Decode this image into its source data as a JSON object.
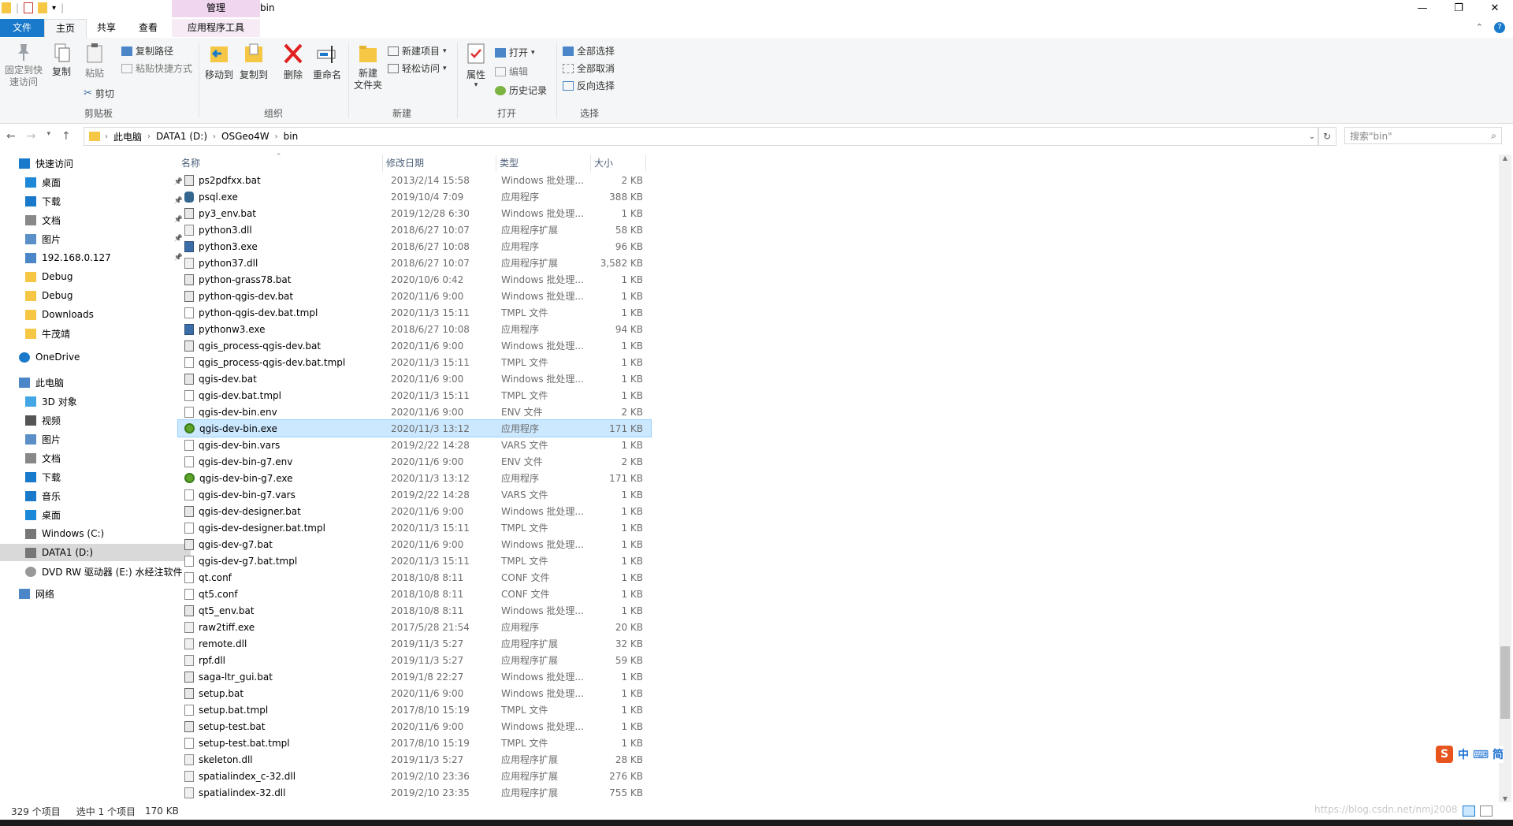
{
  "window": {
    "title": "bin",
    "context_tab_header": "管理",
    "controls": [
      "—",
      "❐",
      "✕"
    ]
  },
  "tabs": {
    "file": "文件",
    "home": "主页",
    "share": "共享",
    "view": "查看",
    "app_tools": "应用程序工具"
  },
  "ribbon": {
    "clipboard": {
      "label": "剪贴板",
      "pin": "固定到快\n速访问",
      "copy": "复制",
      "paste": "粘贴",
      "copy_path": "复制路径",
      "paste_shortcut": "粘贴快捷方式",
      "cut": "剪切"
    },
    "organize": {
      "label": "组织",
      "move_to": "移动到",
      "copy_to": "复制到",
      "delete": "删除",
      "rename": "重命名"
    },
    "new": {
      "label": "新建",
      "new_folder": "新建\n文件夹",
      "new_item": "新建项目",
      "easy_access": "轻松访问"
    },
    "open": {
      "label": "打开",
      "properties": "属性",
      "open": "打开",
      "edit": "编辑",
      "history": "历史记录"
    },
    "select": {
      "label": "选择",
      "select_all": "全部选择",
      "select_none": "全部取消",
      "invert": "反向选择"
    }
  },
  "address": {
    "crumbs": [
      "此电脑",
      "DATA1 (D:)",
      "OSGeo4W",
      "bin"
    ],
    "search_placeholder": "搜索\"bin\""
  },
  "nav": [
    {
      "label": "快速访问",
      "icon": "star-icon",
      "indent": 0,
      "pinned": false
    },
    {
      "label": "桌面",
      "icon": "desktop-icon",
      "indent": 1,
      "pinned": true
    },
    {
      "label": "下载",
      "icon": "download-icon",
      "indent": 1,
      "pinned": true
    },
    {
      "label": "文档",
      "icon": "document-icon",
      "indent": 1,
      "pinned": true
    },
    {
      "label": "图片",
      "icon": "pictures-icon",
      "indent": 1,
      "pinned": true
    },
    {
      "label": "192.168.0.127",
      "icon": "network-drive-icon",
      "indent": 1,
      "pinned": true
    },
    {
      "label": "Debug",
      "icon": "folder-icon",
      "indent": 1,
      "pinned": false
    },
    {
      "label": "Debug",
      "icon": "folder-icon",
      "indent": 1,
      "pinned": false
    },
    {
      "label": "Downloads",
      "icon": "folder-icon",
      "indent": 1,
      "pinned": false
    },
    {
      "label": "牛茂靖",
      "icon": "folder-icon",
      "indent": 1,
      "pinned": false
    },
    {
      "label": "OneDrive",
      "icon": "cloud-icon",
      "indent": 0,
      "pinned": false
    },
    {
      "label": "此电脑",
      "icon": "computer-icon",
      "indent": 0,
      "pinned": false
    },
    {
      "label": "3D 对象",
      "icon": "cube-icon",
      "indent": 1,
      "pinned": false
    },
    {
      "label": "视频",
      "icon": "video-icon",
      "indent": 1,
      "pinned": false
    },
    {
      "label": "图片",
      "icon": "pictures-icon",
      "indent": 1,
      "pinned": false
    },
    {
      "label": "文档",
      "icon": "document-icon",
      "indent": 1,
      "pinned": false
    },
    {
      "label": "下载",
      "icon": "download-icon",
      "indent": 1,
      "pinned": false
    },
    {
      "label": "音乐",
      "icon": "music-icon",
      "indent": 1,
      "pinned": false
    },
    {
      "label": "桌面",
      "icon": "desktop-icon",
      "indent": 1,
      "pinned": false
    },
    {
      "label": "Windows (C:)",
      "icon": "drive-icon",
      "indent": 1,
      "pinned": false
    },
    {
      "label": "DATA1 (D:)",
      "icon": "drive-icon",
      "indent": 1,
      "pinned": false,
      "selected": true
    },
    {
      "label": "DVD RW 驱动器 (E:) 水经注软件",
      "icon": "dvd-icon",
      "indent": 1,
      "pinned": false
    },
    {
      "label": "网络",
      "icon": "network-icon",
      "indent": 0,
      "pinned": false
    }
  ],
  "columns": {
    "name": "名称",
    "date": "修改日期",
    "type": "类型",
    "size": "大小"
  },
  "files": [
    {
      "name": "ps2pdfxx.bat",
      "date": "2013/2/14 15:58",
      "type": "Windows 批处理...",
      "size": "2 KB",
      "icon": "bat"
    },
    {
      "name": "psql.exe",
      "date": "2019/10/4 7:09",
      "type": "应用程序",
      "size": "388 KB",
      "icon": "psql"
    },
    {
      "name": "py3_env.bat",
      "date": "2019/12/28 6:30",
      "type": "Windows 批处理...",
      "size": "1 KB",
      "icon": "bat"
    },
    {
      "name": "python3.dll",
      "date": "2018/6/27 10:07",
      "type": "应用程序扩展",
      "size": "58 KB",
      "icon": "dll"
    },
    {
      "name": "python3.exe",
      "date": "2018/6/27 10:08",
      "type": "应用程序",
      "size": "96 KB",
      "icon": "py"
    },
    {
      "name": "python37.dll",
      "date": "2018/6/27 10:07",
      "type": "应用程序扩展",
      "size": "3,582 KB",
      "icon": "dll"
    },
    {
      "name": "python-grass78.bat",
      "date": "2020/10/6 0:42",
      "type": "Windows 批处理...",
      "size": "1 KB",
      "icon": "bat"
    },
    {
      "name": "python-qgis-dev.bat",
      "date": "2020/11/6 9:00",
      "type": "Windows 批处理...",
      "size": "1 KB",
      "icon": "bat"
    },
    {
      "name": "python-qgis-dev.bat.tmpl",
      "date": "2020/11/3 15:11",
      "type": "TMPL 文件",
      "size": "1 KB",
      "icon": "doc"
    },
    {
      "name": "pythonw3.exe",
      "date": "2018/6/27 10:08",
      "type": "应用程序",
      "size": "94 KB",
      "icon": "py"
    },
    {
      "name": "qgis_process-qgis-dev.bat",
      "date": "2020/11/6 9:00",
      "type": "Windows 批处理...",
      "size": "1 KB",
      "icon": "bat"
    },
    {
      "name": "qgis_process-qgis-dev.bat.tmpl",
      "date": "2020/11/3 15:11",
      "type": "TMPL 文件",
      "size": "1 KB",
      "icon": "doc"
    },
    {
      "name": "qgis-dev.bat",
      "date": "2020/11/6 9:00",
      "type": "Windows 批处理...",
      "size": "1 KB",
      "icon": "bat"
    },
    {
      "name": "qgis-dev.bat.tmpl",
      "date": "2020/11/3 15:11",
      "type": "TMPL 文件",
      "size": "1 KB",
      "icon": "doc"
    },
    {
      "name": "qgis-dev-bin.env",
      "date": "2020/11/6 9:00",
      "type": "ENV 文件",
      "size": "2 KB",
      "icon": "doc"
    },
    {
      "name": "qgis-dev-bin.exe",
      "date": "2020/11/3 13:12",
      "type": "应用程序",
      "size": "171 KB",
      "icon": "qgis",
      "selected": true
    },
    {
      "name": "qgis-dev-bin.vars",
      "date": "2019/2/22 14:28",
      "type": "VARS 文件",
      "size": "1 KB",
      "icon": "doc"
    },
    {
      "name": "qgis-dev-bin-g7.env",
      "date": "2020/11/6 9:00",
      "type": "ENV 文件",
      "size": "2 KB",
      "icon": "doc"
    },
    {
      "name": "qgis-dev-bin-g7.exe",
      "date": "2020/11/3 13:12",
      "type": "应用程序",
      "size": "171 KB",
      "icon": "qgis"
    },
    {
      "name": "qgis-dev-bin-g7.vars",
      "date": "2019/2/22 14:28",
      "type": "VARS 文件",
      "size": "1 KB",
      "icon": "doc"
    },
    {
      "name": "qgis-dev-designer.bat",
      "date": "2020/11/6 9:00",
      "type": "Windows 批处理...",
      "size": "1 KB",
      "icon": "bat"
    },
    {
      "name": "qgis-dev-designer.bat.tmpl",
      "date": "2020/11/3 15:11",
      "type": "TMPL 文件",
      "size": "1 KB",
      "icon": "doc"
    },
    {
      "name": "qgis-dev-g7.bat",
      "date": "2020/11/6 9:00",
      "type": "Windows 批处理...",
      "size": "1 KB",
      "icon": "bat"
    },
    {
      "name": "qgis-dev-g7.bat.tmpl",
      "date": "2020/11/3 15:11",
      "type": "TMPL 文件",
      "size": "1 KB",
      "icon": "doc"
    },
    {
      "name": "qt.conf",
      "date": "2018/10/8 8:11",
      "type": "CONF 文件",
      "size": "1 KB",
      "icon": "doc"
    },
    {
      "name": "qt5.conf",
      "date": "2018/10/8 8:11",
      "type": "CONF 文件",
      "size": "1 KB",
      "icon": "doc"
    },
    {
      "name": "qt5_env.bat",
      "date": "2018/10/8 8:11",
      "type": "Windows 批处理...",
      "size": "1 KB",
      "icon": "bat"
    },
    {
      "name": "raw2tiff.exe",
      "date": "2017/5/28 21:54",
      "type": "应用程序",
      "size": "20 KB",
      "icon": "dll"
    },
    {
      "name": "remote.dll",
      "date": "2019/11/3 5:27",
      "type": "应用程序扩展",
      "size": "32 KB",
      "icon": "dll"
    },
    {
      "name": "rpf.dll",
      "date": "2019/11/3 5:27",
      "type": "应用程序扩展",
      "size": "59 KB",
      "icon": "dll"
    },
    {
      "name": "saga-ltr_gui.bat",
      "date": "2019/1/8 22:27",
      "type": "Windows 批处理...",
      "size": "1 KB",
      "icon": "bat"
    },
    {
      "name": "setup.bat",
      "date": "2020/11/6 9:00",
      "type": "Windows 批处理...",
      "size": "1 KB",
      "icon": "bat"
    },
    {
      "name": "setup.bat.tmpl",
      "date": "2017/8/10 15:19",
      "type": "TMPL 文件",
      "size": "1 KB",
      "icon": "doc"
    },
    {
      "name": "setup-test.bat",
      "date": "2020/11/6 9:00",
      "type": "Windows 批处理...",
      "size": "1 KB",
      "icon": "bat"
    },
    {
      "name": "setup-test.bat.tmpl",
      "date": "2017/8/10 15:19",
      "type": "TMPL 文件",
      "size": "1 KB",
      "icon": "doc"
    },
    {
      "name": "skeleton.dll",
      "date": "2019/11/3 5:27",
      "type": "应用程序扩展",
      "size": "28 KB",
      "icon": "dll"
    },
    {
      "name": "spatialindex_c-32.dll",
      "date": "2019/2/10 23:36",
      "type": "应用程序扩展",
      "size": "276 KB",
      "icon": "dll"
    },
    {
      "name": "spatialindex-32.dll",
      "date": "2019/2/10 23:35",
      "type": "应用程序扩展",
      "size": "755 KB",
      "icon": "dll"
    }
  ],
  "status": {
    "item_count": "329 个项目",
    "selected": "选中 1 个项目",
    "selected_size": "170 KB"
  },
  "ime": {
    "label": "中 ⌨ 简"
  },
  "watermark": "https://blog.csdn.net/nmj2008",
  "colors": {
    "accent": "#1979ca",
    "selection": "#cce8ff",
    "context_tab": "#f0d7ef"
  }
}
